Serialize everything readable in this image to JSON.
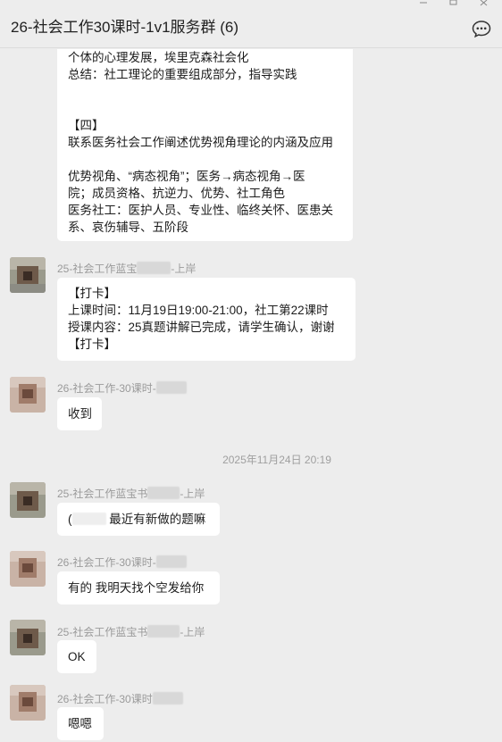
{
  "header": {
    "chat_title": "26-社会工作30课时-1v1服务群 (6)",
    "more_icon": "chat-bubble-more-icon"
  },
  "messages": {
    "m1": {
      "lines_a": [
        "个体的心理发展，埃里克森社会化",
        "总结：社工理论的重要组成部分，指导实践"
      ],
      "lines_b": [
        "【四】",
        "联系医务社会工作阐述优势视角理论的内涵及应用"
      ],
      "lines_c": [
        "优势视角、“病态视角”；医务→病态视角→医",
        "院；成员资格、抗逆力、优势、社工角色",
        "医务社工：医护人员、专业性、临终关怀、医患关",
        "系、哀伤辅导、五阶段"
      ]
    },
    "m2": {
      "sender_prefix": "25-社会工作蓝宝",
      "sender_suffix": "-上岸",
      "lines": [
        "【打卡】",
        "上课时间：11月19日19:00-21:00，社工第22课时",
        "授课内容：25真题讲解已完成，请学生确认，谢谢",
        "【打卡】"
      ]
    },
    "m3": {
      "sender_prefix": "26-社会工作-30课时-",
      "text": "收到"
    },
    "timestamp": "2025年11月24日 20:19",
    "m4": {
      "sender_prefix": "25-社会工作蓝宝书",
      "sender_suffix": "-上岸",
      "text_prefix": "(",
      "text": " 最近有新做的题嘛"
    },
    "m5": {
      "sender_prefix": "26-社会工作-30课时-",
      "text": "有的 我明天找个空发给你"
    },
    "m6": {
      "sender_prefix": "25-社会工作蓝宝书",
      "sender_suffix": "-上岸",
      "text": "OK"
    },
    "m7": {
      "sender_prefix": "26-社会工作-30课时",
      "text": "嗯嗯"
    }
  },
  "colors": {
    "background": "#ededed",
    "bubble": "#ffffff",
    "sender_text": "#9a9a9a"
  }
}
